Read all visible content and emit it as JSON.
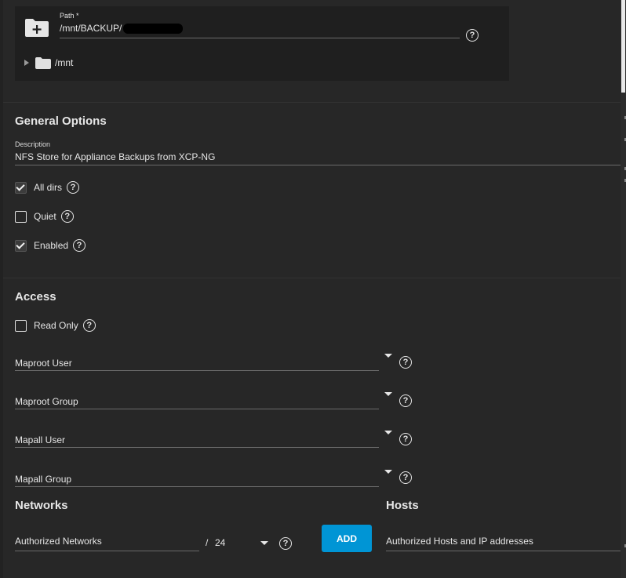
{
  "path": {
    "label": "Path *",
    "value": "/mnt/BACKUP/",
    "tree_root": "/mnt"
  },
  "general": {
    "title": "General Options",
    "description_label": "Description",
    "description_value": "NFS Store for Appliance Backups from XCP-NG",
    "all_dirs": {
      "label": "All dirs",
      "checked": true
    },
    "quiet": {
      "label": "Quiet",
      "checked": false
    },
    "enabled": {
      "label": "Enabled",
      "checked": true
    }
  },
  "access": {
    "title": "Access",
    "read_only": {
      "label": "Read Only",
      "checked": false
    },
    "maproot_user": "Maproot User",
    "maproot_group": "Maproot Group",
    "mapall_user": "Mapall User",
    "mapall_group": "Mapall Group"
  },
  "networks": {
    "title": "Networks",
    "authorized_label": "Authorized Networks",
    "slash": "/",
    "cidr": "24",
    "add_label": "ADD"
  },
  "hosts": {
    "title": "Hosts",
    "authorized_label": "Authorized Hosts and IP addresses"
  },
  "help_glyph": "?",
  "colors": {
    "accent": "#0095d5",
    "background": "#272727",
    "card": "#1f1f1f"
  }
}
